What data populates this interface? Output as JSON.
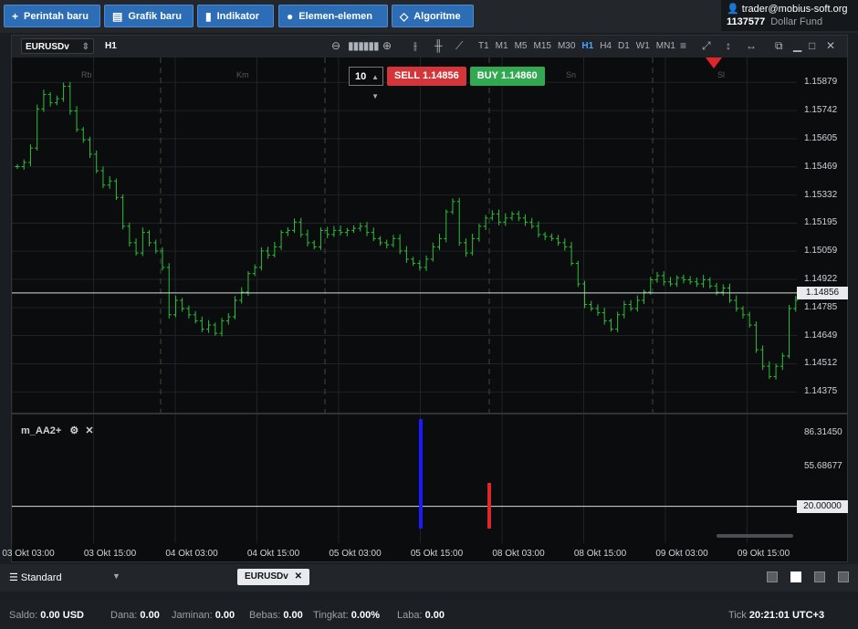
{
  "toolbar": {
    "buttons": [
      {
        "label": "Perintah baru",
        "icon": "plus-icon"
      },
      {
        "label": "Grafik baru",
        "icon": "chart-icon"
      },
      {
        "label": "Indikator",
        "icon": "bars-icon"
      },
      {
        "label": "Elemen-elemen",
        "icon": "shapes-icon"
      },
      {
        "label": "Algoritme",
        "icon": "diamond-icon"
      }
    ]
  },
  "account": {
    "email": "trader@mobius-soft.org",
    "number": "1137577",
    "fund": "Dollar Fund"
  },
  "chart": {
    "symbol": "EURUSDv",
    "timeframe": "H1",
    "timeframes": [
      "T1",
      "M1",
      "M5",
      "M15",
      "M30",
      "H1",
      "H4",
      "D1",
      "W1",
      "MN1"
    ],
    "active_timeframe": "H1",
    "quantity": "10",
    "sell_label": "SELL",
    "sell_price": "1.14856",
    "buy_label": "BUY",
    "buy_price": "1.14860",
    "sessions": [
      "Rb",
      "Km",
      "Sn",
      "Sl"
    ],
    "last_price": "1.14856",
    "y_labels": [
      "1.15879",
      "1.15742",
      "1.15605",
      "1.15469",
      "1.15332",
      "1.15195",
      "1.15059",
      "1.14922",
      "1.14785",
      "1.14649",
      "1.14512",
      "1.14375"
    ],
    "indicator_name": "m_AA2+",
    "indicator_labels": [
      "86.31450",
      "55.68677"
    ],
    "indicator_level": "20.00000",
    "x_labels": [
      "03 Okt 03:00",
      "03 Okt 15:00",
      "04 Okt 03:00",
      "04 Okt 15:00",
      "05 Okt 03:00",
      "05 Okt 15:00",
      "08 Okt 03:00",
      "08 Okt 15:00",
      "09 Okt 03:00",
      "09 Okt 15:00"
    ]
  },
  "bottom": {
    "workspace": "Standard",
    "tab": "EURUSDv"
  },
  "status": {
    "saldo_label": "Saldo:",
    "saldo": "0.00",
    "currency": "USD",
    "dana_label": "Dana:",
    "dana": "0.00",
    "jaminan_label": "Jaminan:",
    "jaminan": "0.00",
    "bebas_label": "Bebas:",
    "bebas": "0.00",
    "tingkat_label": "Tingkat:",
    "tingkat": "0.00%",
    "laba_label": "Laba:",
    "laba": "0.00",
    "tick_label": "Tick",
    "time": "20:21:01",
    "tz": "UTC+3"
  }
}
